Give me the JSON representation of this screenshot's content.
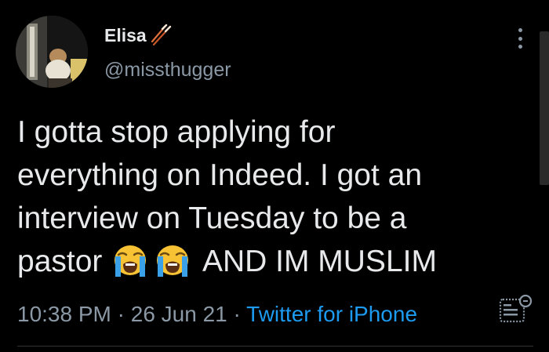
{
  "tweet": {
    "author": {
      "name": "Elisa",
      "name_emoji": "chopsticks-emoji",
      "handle": "@missthugger",
      "avatar": "profile-photo"
    },
    "body": {
      "line1": "I gotta stop applying for",
      "line2": "everything on Indeed. I got an",
      "line3": "interview on Tuesday to be a",
      "line4_start": "pastor",
      "emojis": [
        "loudly-crying-face-emoji",
        "loudly-crying-face-emoji"
      ],
      "line4_end": "AND IM MUSLIM"
    },
    "meta": {
      "time": "10:38 PM",
      "separator": "·",
      "date": "26 Jun 21",
      "source": "Twitter for iPhone"
    },
    "icons": {
      "more": "more-options-icon",
      "analytics": "view-activity-icon"
    }
  },
  "colors": {
    "background": "#000000",
    "text_primary": "#e7e9ea",
    "text_secondary": "#8b98a5",
    "accent": "#1d9bf0"
  }
}
